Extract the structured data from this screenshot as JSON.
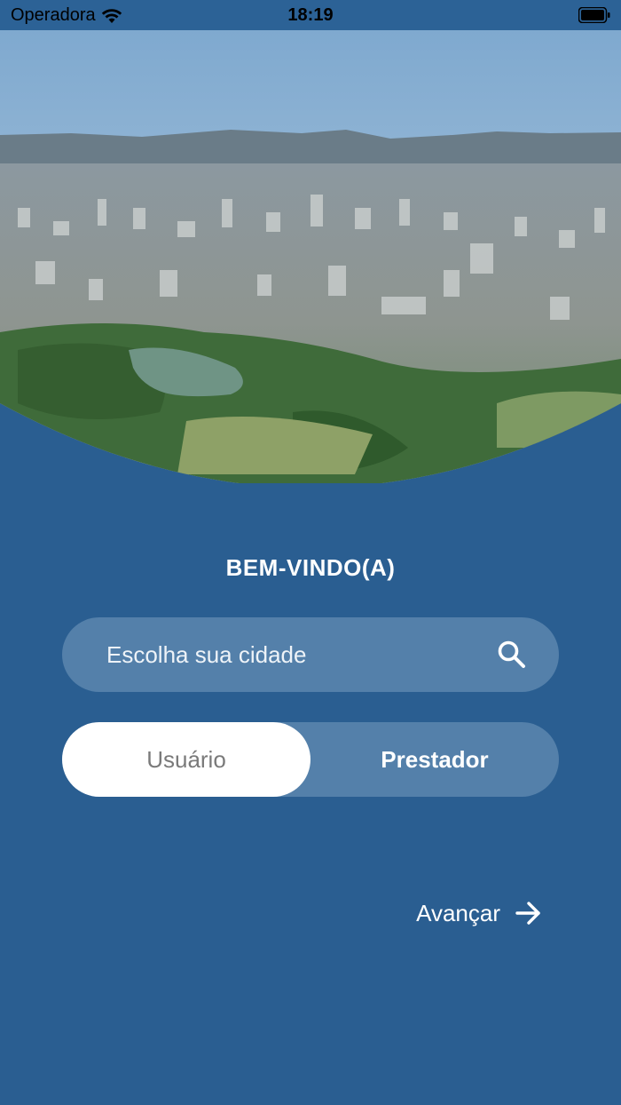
{
  "status_bar": {
    "carrier": "Operadora",
    "time": "18:19"
  },
  "hero": {
    "image": "aerial-city-view"
  },
  "welcome": {
    "title": "BEM-VINDO(A)"
  },
  "search": {
    "placeholder": "Escolha sua cidade",
    "icon": "search-icon"
  },
  "user_type_toggle": {
    "options": [
      "Usuário",
      "Prestador"
    ],
    "selected": "Usuário"
  },
  "advance": {
    "label": "Avançar",
    "icon": "arrow-right-icon"
  },
  "colors": {
    "background": "#2a5e91",
    "field": "#5480aa",
    "selected_option": "#ffffff",
    "selected_text": "#7a7a7a"
  }
}
